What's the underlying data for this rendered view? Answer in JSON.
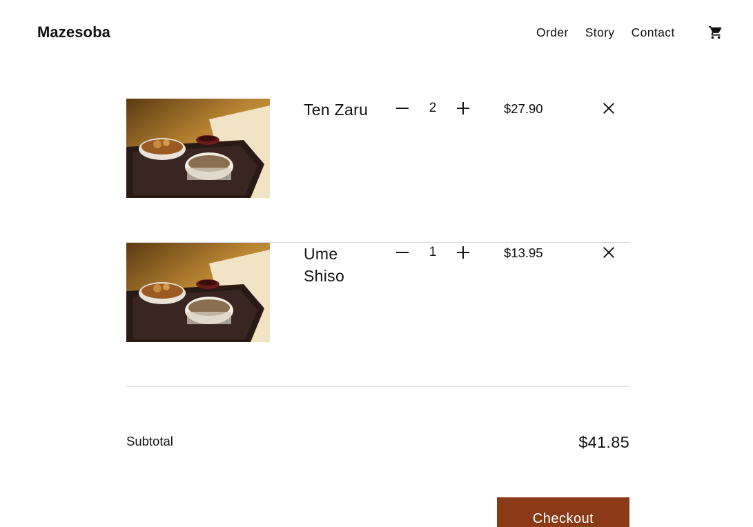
{
  "header": {
    "brand": "Mazesoba",
    "nav": [
      "Order",
      "Story",
      "Contact"
    ],
    "cart_icon": "shopping-cart-icon"
  },
  "cart": {
    "items": [
      {
        "name": "Ten Zaru",
        "quantity": "2",
        "price": "$27.90",
        "image": "ten-zaru-meal-photo"
      },
      {
        "name": "Ume Shiso",
        "quantity": "1",
        "price": "$13.95",
        "image": "ume-shiso-meal-photo"
      }
    ],
    "decrease_icon": "minus-icon",
    "increase_icon": "plus-icon",
    "remove_icon": "close-icon"
  },
  "summary": {
    "subtotal_label": "Subtotal",
    "subtotal_value": "$41.85",
    "checkout_label": "Checkout"
  },
  "colors": {
    "accent": "#8a3a16",
    "divider": "#d9d9d9",
    "text": "#111111"
  }
}
